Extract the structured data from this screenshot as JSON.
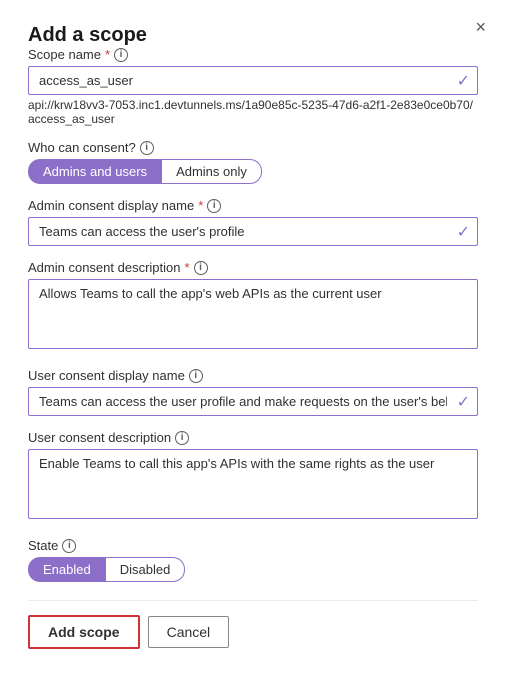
{
  "dialog": {
    "title": "Add a scope",
    "close_label": "×"
  },
  "scope_name": {
    "label": "Scope name",
    "required_marker": " *",
    "value": "access_as_user",
    "url": "api://krw18vv3-7053.inc1.devtunnels.ms/1a90e85c-5235-47d6-a2f1-2e83e0ce0b70/access_as_user"
  },
  "who_can_consent": {
    "label": "Who can consent?",
    "options": [
      {
        "label": "Admins and users",
        "active": true
      },
      {
        "label": "Admins only",
        "active": false
      }
    ]
  },
  "admin_consent_display_name": {
    "label": "Admin consent display name",
    "required_marker": " *",
    "value": "Teams can access the user's profile"
  },
  "admin_consent_description": {
    "label": "Admin consent description",
    "required_marker": " *",
    "value": "Allows Teams to call the app's web APIs as the current user"
  },
  "user_consent_display_name": {
    "label": "User consent display name",
    "value": "Teams can access the user profile and make requests on the user's behalf"
  },
  "user_consent_description": {
    "label": "User consent description",
    "value": "Enable Teams to call this app's APIs with the same rights as the user"
  },
  "state": {
    "label": "State",
    "options": [
      {
        "label": "Enabled",
        "active": true
      },
      {
        "label": "Disabled",
        "active": false
      }
    ]
  },
  "buttons": {
    "add_scope": "Add scope",
    "cancel": "Cancel"
  },
  "icons": {
    "info": "i",
    "check": "✓",
    "close": "×"
  }
}
